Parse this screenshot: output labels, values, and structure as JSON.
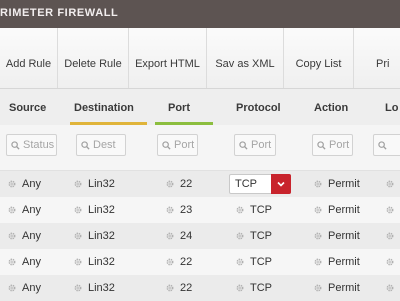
{
  "window": {
    "title": "RIMETER FIREWALL"
  },
  "toolbar": {
    "add_rule": "Add Rule",
    "delete_rule": "Delete Rule",
    "export_html": "Export HTML",
    "save_xml": "Sav as XML",
    "copy_list": "Copy List",
    "print": "Pri"
  },
  "columns": {
    "source": "Source",
    "destination": "Destination",
    "port": "Port",
    "protocol": "Protocol",
    "action": "Action",
    "log": "Lo"
  },
  "filters": {
    "source": "Status",
    "destination": "Dest",
    "port": "Port",
    "protocol": "Port",
    "action": "Port"
  },
  "rows": [
    {
      "source": "Any",
      "destination": "Lin32",
      "port": "22",
      "protocol": "TCP",
      "action": "Permit"
    },
    {
      "source": "Any",
      "destination": "Lin32",
      "port": "23",
      "protocol": "TCP",
      "action": "Permit"
    },
    {
      "source": "Any",
      "destination": "Lin32",
      "port": "24",
      "protocol": "TCP",
      "action": "Permit"
    },
    {
      "source": "Any",
      "destination": "Lin32",
      "port": "22",
      "protocol": "TCP",
      "action": "Permit"
    },
    {
      "source": "Any",
      "destination": "Lin32",
      "port": "22",
      "protocol": "TCP",
      "action": "Permit"
    }
  ],
  "colors": {
    "titlebar": "#5d5452",
    "destination_underline": "#e0b43a",
    "port_underline": "#8cbe3f",
    "dropdown_accent": "#c8232c"
  },
  "icons": {
    "filter": "search-icon",
    "row_cell": "gear-icon",
    "dropdown": "chevron-down-icon"
  }
}
